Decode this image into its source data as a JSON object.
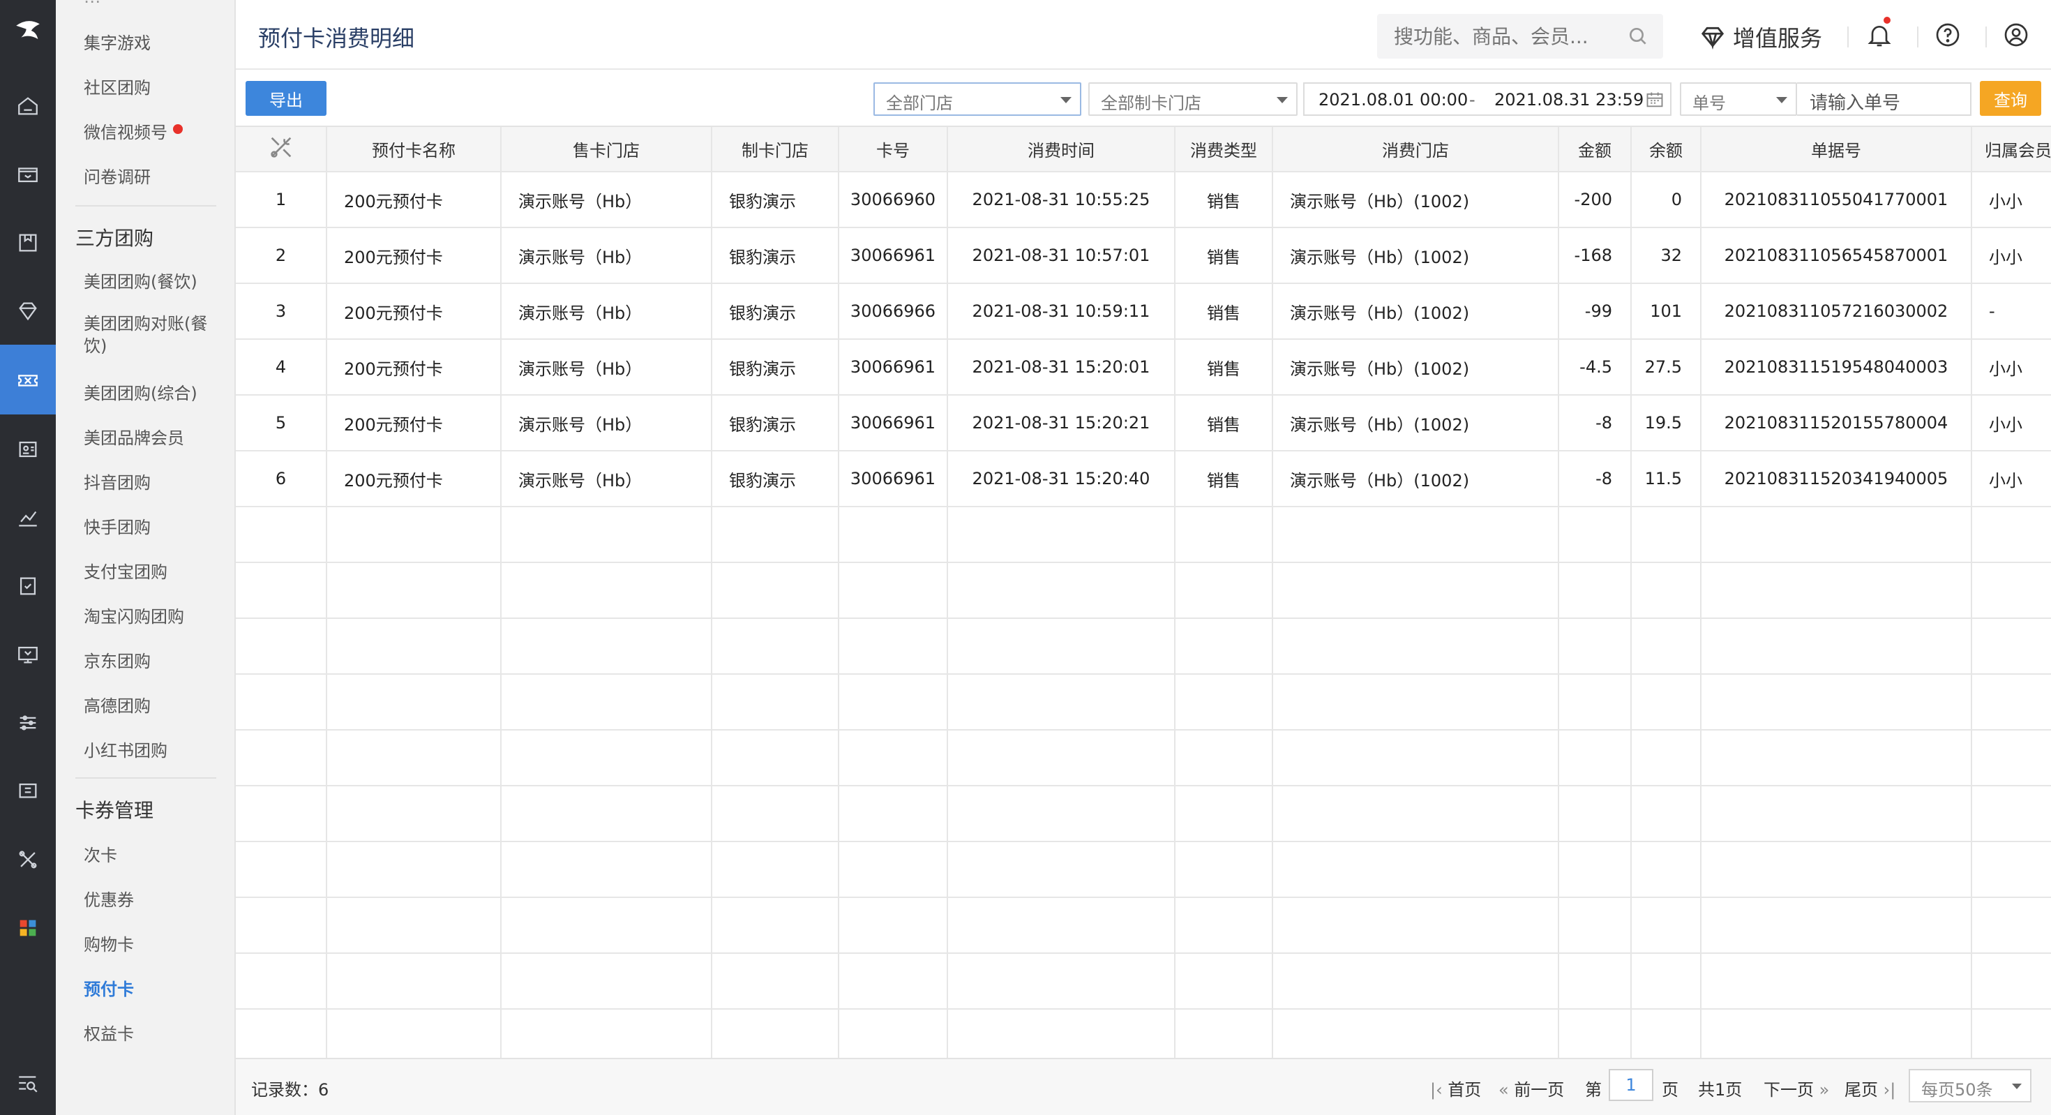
{
  "nav": {
    "items": [
      {
        "label": "集字游戏",
        "dot": false
      },
      {
        "label": "社区团购",
        "dot": false
      },
      {
        "label": "微信视频号",
        "dot": true
      },
      {
        "label": "问卷调研",
        "dot": false
      }
    ],
    "group_thirdparty": "三方团购",
    "thirdparty_items": [
      "美团团购(餐饮)",
      "美团团购对账(餐饮)",
      "美团团购(综合)",
      "美团品牌会员",
      "抖音团购",
      "快手团购",
      "支付宝团购",
      "淘宝闪购团购",
      "京东团购",
      "高德团购",
      "小红书团购"
    ],
    "group_card": "卡券管理",
    "card_items": [
      "次卡",
      "优惠券",
      "购物卡",
      "预付卡",
      "权益卡"
    ],
    "active_item": "预付卡"
  },
  "header": {
    "title": "预付卡消费明细",
    "search_placeholder": "搜功能、商品、会员...",
    "value_added": "增值服务"
  },
  "toolbar": {
    "export_label": "导出",
    "store_select": "全部门店",
    "card_store_select": "全部制卡门店",
    "date_start": "2021.08.01 00:00",
    "date_sep": "-",
    "date_end": "2021.08.31 23:59",
    "order_type": "单号",
    "order_placeholder": "请输入单号",
    "query_label": "查询"
  },
  "table": {
    "headers": [
      "预付卡名称",
      "售卡门店",
      "制卡门店",
      "卡号",
      "消费时间",
      "消费类型",
      "消费门店",
      "金额",
      "余额",
      "单据号",
      "归属会员"
    ],
    "rows": [
      [
        "1",
        "200元预付卡",
        "演示账号（Hb）",
        "银豹演示",
        "30066960",
        "2021-08-31 10:55:25",
        "销售",
        "演示账号（Hb）(1002)",
        "-200",
        "0",
        "20210831105504177000​1",
        "小小"
      ],
      [
        "2",
        "200元预付卡",
        "演示账号（Hb）",
        "银豹演示",
        "30066961",
        "2021-08-31 10:57:01",
        "销售",
        "演示账号（Hb）(1002)",
        "-168",
        "32",
        "202108311056545870001",
        "小小"
      ],
      [
        "3",
        "200元预付卡",
        "演示账号（Hb）",
        "银豹演示",
        "30066966",
        "2021-08-31 10:59:11",
        "销售",
        "演示账号（Hb）(1002)",
        "-99",
        "101",
        "202108311057216030002",
        "-"
      ],
      [
        "4",
        "200元预付卡",
        "演示账号（Hb）",
        "银豹演示",
        "30066961",
        "2021-08-31 15:20:01",
        "销售",
        "演示账号（Hb）(1002)",
        "-4.5",
        "27.5",
        "202108311519548040003",
        "小小"
      ],
      [
        "5",
        "200元预付卡",
        "演示账号（Hb）",
        "银豹演示",
        "30066961",
        "2021-08-31 15:20:21",
        "销售",
        "演示账号（Hb）(1002)",
        "-8",
        "19.5",
        "202108311520155780004",
        "小小"
      ],
      [
        "6",
        "200元预付卡",
        "演示账号（Hb）",
        "银豹演示",
        "30066961",
        "2021-08-31 15:20:40",
        "销售",
        "演示账号（Hb）(1002)",
        "-8",
        "11.5",
        "202108311520341940005",
        "小小"
      ]
    ]
  },
  "footer": {
    "records": "记录数：6",
    "first": "首页",
    "prev": "前一页",
    "page_prefix": "第",
    "page_value": "1",
    "page_suffix": "页",
    "total": "共1页",
    "next": "下一页",
    "last": "尾页",
    "page_size": "每页50条"
  },
  "colors": {
    "accent": "#3d86dc",
    "query": "#f5a623",
    "rail": "#2b2d32",
    "active_rail": "#3d7fd7"
  }
}
